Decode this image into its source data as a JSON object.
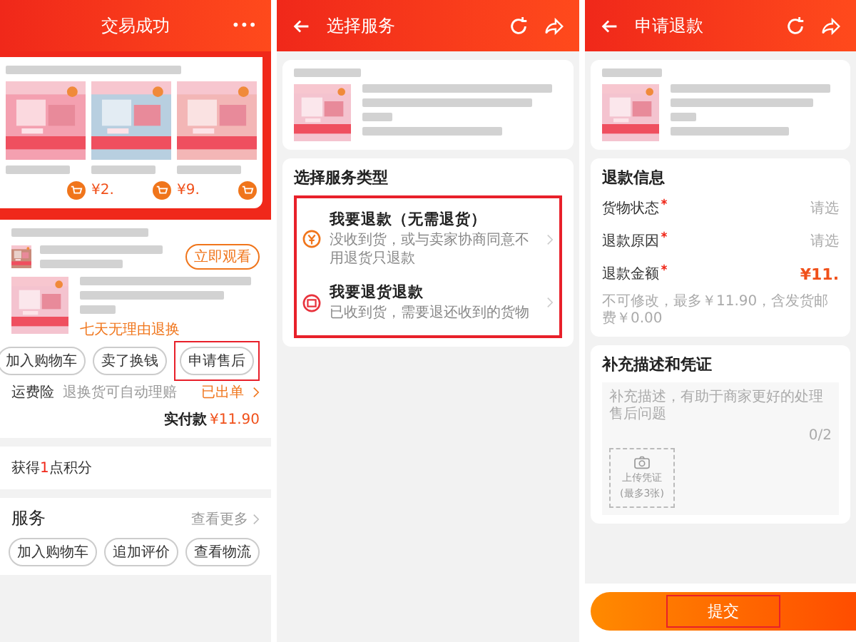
{
  "order_screen": {
    "title": "交易成功",
    "more": "•••",
    "products": [
      {
        "kind": "unpriced"
      },
      {
        "kind": "priced",
        "price": "¥2."
      },
      {
        "kind": "priced",
        "price": "¥9."
      }
    ],
    "watch_button": "立即观看",
    "return_policy": "七天无理由退换",
    "item_buttons": [
      {
        "label": "加入购物车",
        "highlighted": false
      },
      {
        "label": "卖了换钱",
        "highlighted": false
      },
      {
        "label": "申请售后",
        "highlighted": true
      }
    ],
    "insurance": {
      "label": "运费险",
      "text": "退换货可自动理赔",
      "status": "已出单"
    },
    "paid": {
      "label": "实付款",
      "amount": "¥11.90"
    },
    "points": {
      "prefix": "获得",
      "count": "1",
      "suffix": "点积分"
    },
    "services": {
      "title": "服务",
      "more": "查看更多"
    },
    "bottom_buttons": [
      "加入购物车",
      "追加评价",
      "查看物流"
    ]
  },
  "service_screen": {
    "title": "选择服务",
    "type_heading": "选择服务类型",
    "highlighted": true,
    "options": [
      {
        "kind": "refund",
        "title": "我要退款（无需退货）",
        "desc": "没收到货，或与卖家协商同意不用退货只退款"
      },
      {
        "kind": "return",
        "title": "我要退货退款",
        "desc": "已收到货，需要退还收到的货物"
      }
    ]
  },
  "refund_screen": {
    "title": "申请退款",
    "info_heading": "退款信息",
    "fields": [
      {
        "label": "货物状态",
        "required": true,
        "value": "请选",
        "kind": "select"
      },
      {
        "label": "退款原因",
        "required": true,
        "value": "请选",
        "kind": "select"
      },
      {
        "label": "退款金额",
        "required": true,
        "value": "¥11.",
        "kind": "amount"
      }
    ],
    "amount_note": "不可修改，最多￥11.90，含发货邮费￥0.00",
    "desc_heading": "补充描述和凭证",
    "placeholder": "补充描述，有助于商家更好的处理售后问题",
    "counter": "0/2",
    "upload": {
      "label": "上传凭证",
      "limit": "(最多3张)"
    },
    "submit": {
      "label": "提交",
      "highlighted": true
    }
  }
}
